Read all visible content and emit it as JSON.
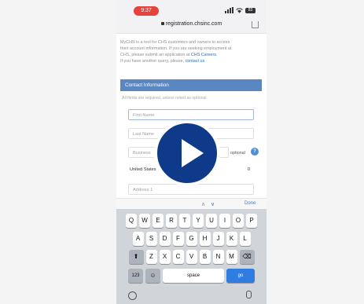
{
  "status": {
    "time": "9:37",
    "battery": "83"
  },
  "browser": {
    "url": "registration.chsinc.com"
  },
  "intro": {
    "line1": "MyCHS is a tool for CHS customers and owners to access",
    "line2": "their account information. If you are seeking employment at",
    "line3_prefix": "CHS, please submit an application at ",
    "careers_link": "CHS Careers",
    "line4_prefix": "If you have another query, please, ",
    "contact_link": "contact us"
  },
  "form": {
    "section_title": "Contact Information",
    "required_note": "All fields are required, unless noted as optional",
    "first_name_placeholder": "First Name",
    "last_name_placeholder": "Last Name",
    "business_placeholder": "Business",
    "optional_label": "optional",
    "country_value": "United States",
    "zip_value": "0",
    "address_placeholder": "Address 1"
  },
  "accessory": {
    "done_label": "Done"
  },
  "keyboard": {
    "row1": [
      "Q",
      "W",
      "E",
      "R",
      "T",
      "Y",
      "U",
      "I",
      "O",
      "P"
    ],
    "row2": [
      "A",
      "S",
      "D",
      "F",
      "G",
      "H",
      "J",
      "K",
      "L"
    ],
    "row3": [
      "Z",
      "X",
      "C",
      "V",
      "B",
      "N",
      "M"
    ],
    "numbers_label": "123",
    "space_label": "space",
    "go_label": "go"
  },
  "colors": {
    "header_blue": "#5a86c2",
    "play_button": "#0f3a8a",
    "key_blue": "#2f7de1",
    "status_red": "#e8403b"
  }
}
